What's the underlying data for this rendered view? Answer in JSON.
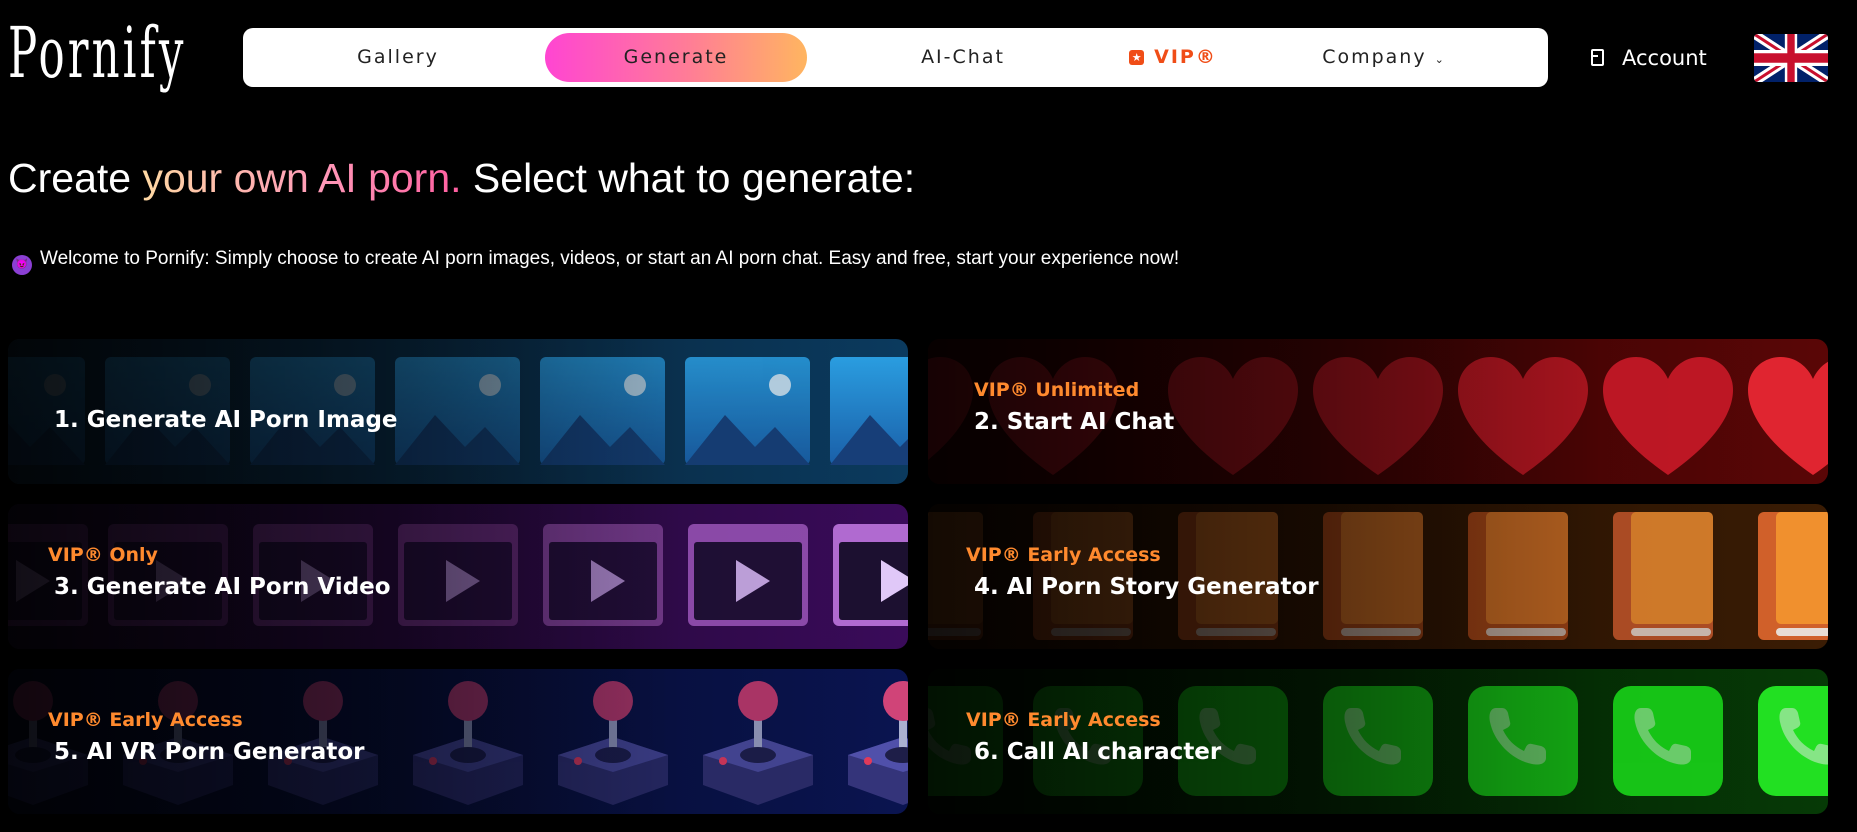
{
  "brand": {
    "logo_text": "Pornify"
  },
  "nav": {
    "items": [
      {
        "label": "Gallery"
      },
      {
        "label": "Generate",
        "active": true
      },
      {
        "label": "AI-Chat"
      },
      {
        "label": "VIP®",
        "icon": "star-badge-icon"
      },
      {
        "label": "Company",
        "icon": "chevron-down-icon"
      }
    ]
  },
  "header": {
    "account_label": "Account",
    "account_icon": "login-icon",
    "language_flag": "uk-flag-icon"
  },
  "headline": {
    "part1": "Create ",
    "highlight": "your own AI porn.",
    "part2": " Select what to generate:"
  },
  "welcome": {
    "icon": "devil-emoji-icon",
    "text": "Welcome to Pornify: Simply choose to create AI porn images, videos, or start an AI porn chat. Easy and free, start your experience now!"
  },
  "cards": [
    {
      "tag": "",
      "title": "1. Generate AI Porn Image",
      "icon": "image-icon",
      "accent": "#1e9be0"
    },
    {
      "tag": "VIP® Unlimited",
      "title": "2. Start AI Chat",
      "icon": "heart-icon",
      "accent": "#e0202e"
    },
    {
      "tag": "VIP® Only",
      "title": "3. Generate AI Porn Video",
      "icon": "video-play-icon",
      "accent": "#b070d8"
    },
    {
      "tag": "VIP® Early Access",
      "title": "4. AI Porn Story Generator",
      "icon": "book-icon",
      "accent": "#e07a2a"
    },
    {
      "tag": "VIP® Early Access",
      "title": "5. AI VR Porn Generator",
      "icon": "joystick-icon",
      "accent": "#3a3f8a"
    },
    {
      "tag": "VIP® Early Access",
      "title": "6. Call AI character",
      "icon": "phone-icon",
      "accent": "#21d821"
    }
  ]
}
